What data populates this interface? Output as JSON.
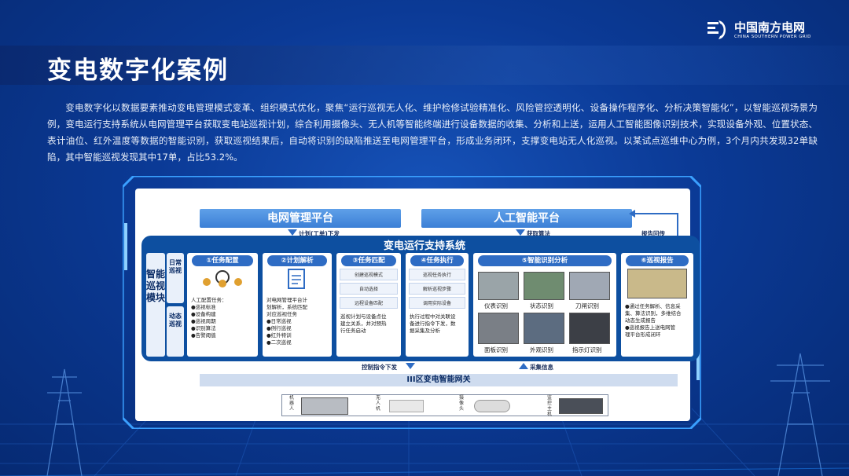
{
  "header": {
    "title": "变电数字化案例",
    "logo_cn": "中国南方电网",
    "logo_en": "CHINA SOUTHERN POWER GRID"
  },
  "intro": "变电数字化以数据要素推动变电管理模式变革、组织模式优化，聚焦“运行巡视无人化、维护检修试验精准化、风险管控透明化、设备操作程序化、分析决策智能化”，以智能巡视场景为例，变电运行支持系统从电网管理平台获取变电站巡视计划，综合利用摄像头、无人机等智能终端进行设备数据的收集、分析和上送，运用人工智能图像识别技术，实现设备外观、位置状态、表计油位、红外温度等数据的智能识别，获取巡视结果后，自动将识别的缺陷推送至电网管理平台，形成业务闭环，支撑变电站无人化巡视。以某试点巡维中心为例，3个月内共发现32单缺陷，其中智能巡视发现其中17单，占比53.2%。",
  "diagram": {
    "platform_grid": "电网管理平台",
    "platform_ai": "人工智能平台",
    "label_plan": "计划(工单)下发",
    "label_algo": "获取算法",
    "label_report": "报告回传",
    "system_title": "变电运行支持系统",
    "module": "智能巡视模块",
    "sub_daily": "日常巡视",
    "sub_dynamic": "动态巡视",
    "steps": [
      {
        "head": "①任务配置",
        "lines": [
          "人工配置任务：",
          "●巡视标准",
          "●设备构建",
          "●巡视周期",
          "●识别算法",
          "●告警阈值"
        ]
      },
      {
        "head": "②计划解析",
        "lines": [
          "对电网管理平台计",
          "划解析，系统匹配",
          "对应巡视任务",
          "●日常巡视",
          "●例行巡视",
          "●红外特训",
          "●二次巡视"
        ]
      },
      {
        "head": "③任务匹配",
        "boxes": [
          "创建巡视模式",
          "自动选择",
          "远程设备匹配"
        ],
        "lines": [
          "巡视计划与设备点位",
          "建立关系，并对预热",
          "行任务启动"
        ]
      },
      {
        "head": "④任务执行",
        "boxes": [
          "巡视任务执行",
          "解析巡视步骤",
          "调用实际设备"
        ],
        "lines": [
          "执行过程中对关联设",
          "备进行指令下发，数",
          "据采集及分析"
        ]
      },
      {
        "head": "⑤智能识别分析",
        "photos": [
          "仪表识别",
          "状态识别",
          "刀闸识别",
          "面板识别",
          "外观识别",
          "指示灯识别"
        ]
      },
      {
        "head": "⑥巡视报告",
        "lines": [
          "●通过任务解析、信息采",
          "集、算法识别，多维结合",
          "动态生成报告",
          "●巡视报告上送电网管",
          "理平台形成闭环"
        ]
      }
    ],
    "label_control": "控制指令下发",
    "label_collect": "采集信息",
    "gateway": "III区变电智能网关",
    "devices": [
      "机器人",
      "无人机",
      "摄像头",
      "监控主机"
    ]
  }
}
